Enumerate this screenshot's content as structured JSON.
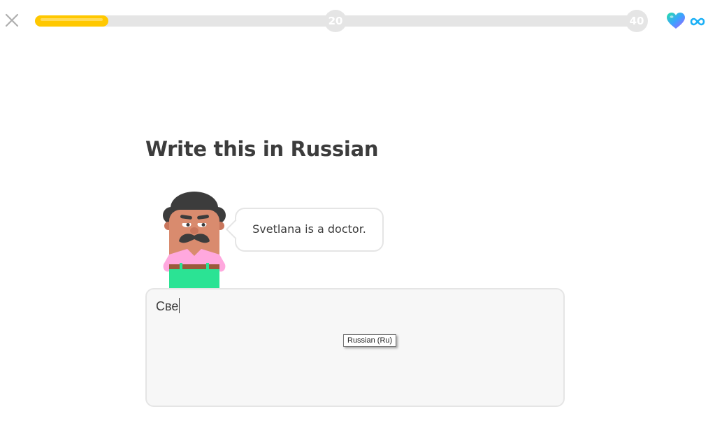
{
  "header": {
    "close_icon": "close-icon",
    "progress": {
      "fraction": 0.12,
      "milestones": [
        "20",
        "40"
      ],
      "fill_color": "#ffc800",
      "track_color": "#e5e5e5"
    },
    "hearts_icon": "heart-icon",
    "hearts_count_icon": "infinity-icon"
  },
  "challenge": {
    "title": "Write this in Russian",
    "prompt": "Svetlana is a doctor.",
    "answer_value": "Све",
    "input_language_tooltip": "Russian (Ru)"
  },
  "colors": {
    "text": "#3c3c3c",
    "border": "#e5e5e5",
    "input_bg": "#f7f7f7"
  }
}
